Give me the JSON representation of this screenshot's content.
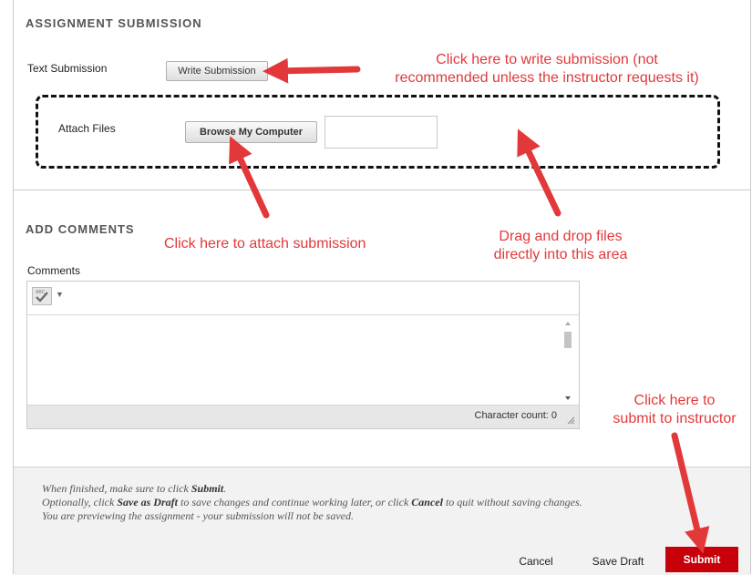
{
  "assignment_section": {
    "title": "ASSIGNMENT SUBMISSION"
  },
  "text_submission": {
    "label": "Text Submission",
    "button": "Write Submission"
  },
  "attach_files": {
    "label": "Attach Files",
    "button": "Browse My Computer"
  },
  "comments_section": {
    "title": "ADD COMMENTS",
    "label": "Comments",
    "character_count": "Character count: 0"
  },
  "annotations": {
    "write_line1": "Click here to write submission (not",
    "write_line2": "recommended unless the instructor requests it)",
    "attach": "Click here to attach submission",
    "drag_line1": "Drag and drop files",
    "drag_line2": "directly into this area",
    "submit_line1": "Click here to",
    "submit_line2": "submit to instructor"
  },
  "instructions": {
    "l1_a": "When finished, make sure to click ",
    "l1_b": "Submit",
    "l1_c": ".",
    "l2_a": "Optionally, click ",
    "l2_b": "Save as Draft",
    "l2_c": " to save changes and continue working later, or click ",
    "l2_d": "Cancel",
    "l2_e": " to quit without saving changes.",
    "l3": "You are previewing the assignment - your submission will not be saved."
  },
  "actions": {
    "cancel": "Cancel",
    "save_draft": "Save Draft",
    "submit": "Submit"
  },
  "colors": {
    "annotation_red": "#e2383a",
    "submit_red": "#c8000a"
  }
}
